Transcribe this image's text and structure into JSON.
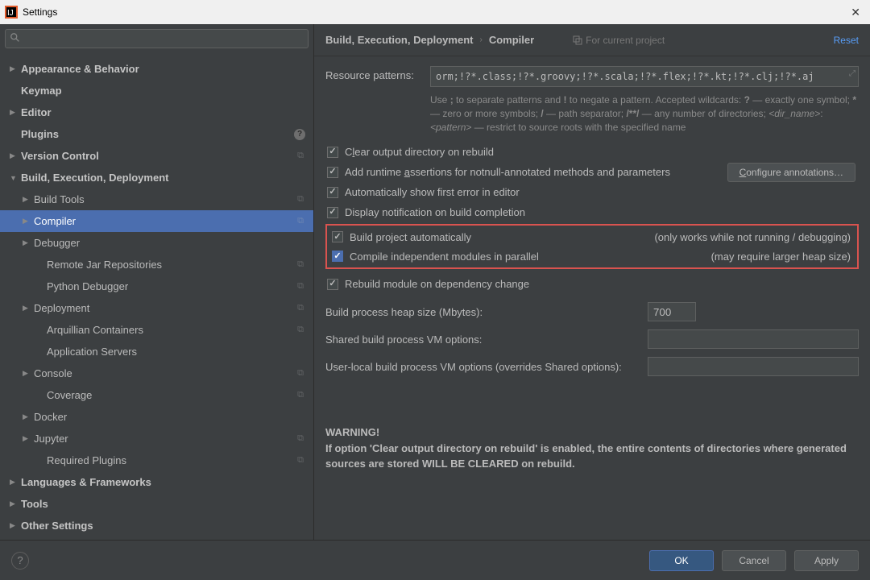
{
  "titlebar": {
    "title": "Settings"
  },
  "search": {
    "placeholder": ""
  },
  "sidebar": {
    "items": [
      {
        "label": "Appearance & Behavior",
        "arrow": "right",
        "lvl": 0,
        "bold": true
      },
      {
        "label": "Keymap",
        "arrow": "none",
        "lvl": 0,
        "bold": true
      },
      {
        "label": "Editor",
        "arrow": "right",
        "lvl": 0,
        "bold": true
      },
      {
        "label": "Plugins",
        "arrow": "none",
        "lvl": 0,
        "bold": true,
        "badge": "?"
      },
      {
        "label": "Version Control",
        "arrow": "right",
        "lvl": 0,
        "bold": true,
        "copy": true
      },
      {
        "label": "Build, Execution, Deployment",
        "arrow": "down",
        "lvl": 0,
        "bold": true
      },
      {
        "label": "Build Tools",
        "arrow": "right",
        "lvl": 1,
        "copy": true
      },
      {
        "label": "Compiler",
        "arrow": "right",
        "lvl": 1,
        "copy": true,
        "selected": true
      },
      {
        "label": "Debugger",
        "arrow": "right",
        "lvl": 1
      },
      {
        "label": "Remote Jar Repositories",
        "arrow": "none",
        "lvl": 2,
        "copy": true
      },
      {
        "label": "Python Debugger",
        "arrow": "none",
        "lvl": 2,
        "copy": true
      },
      {
        "label": "Deployment",
        "arrow": "right",
        "lvl": 1,
        "copy": true
      },
      {
        "label": "Arquillian Containers",
        "arrow": "none",
        "lvl": 2,
        "copy": true
      },
      {
        "label": "Application Servers",
        "arrow": "none",
        "lvl": 2
      },
      {
        "label": "Console",
        "arrow": "right",
        "lvl": 1,
        "copy": true
      },
      {
        "label": "Coverage",
        "arrow": "none",
        "lvl": 2,
        "copy": true
      },
      {
        "label": "Docker",
        "arrow": "right",
        "lvl": 1
      },
      {
        "label": "Jupyter",
        "arrow": "right",
        "lvl": 1,
        "copy": true
      },
      {
        "label": "Required Plugins",
        "arrow": "none",
        "lvl": 2,
        "copy": true
      },
      {
        "label": "Languages & Frameworks",
        "arrow": "right",
        "lvl": 0,
        "bold": true
      },
      {
        "label": "Tools",
        "arrow": "right",
        "lvl": 0,
        "bold": true
      },
      {
        "label": "Other Settings",
        "arrow": "right",
        "lvl": 0,
        "bold": true
      }
    ]
  },
  "header": {
    "crumb1": "Build, Execution, Deployment",
    "crumb2": "Compiler",
    "for_project": "For current project",
    "reset": "Reset"
  },
  "form": {
    "resource_label": "Resource patterns:",
    "resource_value": "orm;!?*.class;!?*.groovy;!?*.scala;!?*.flex;!?*.kt;!?*.clj;!?*.aj",
    "hint1": "Use ; to separate patterns and ! to negate a pattern. Accepted wildcards: ? — exactly one symbol; * — zero or more symbols; / — path separator; /**/ — any number of directories; <dir_name>:<pattern> — restrict to source roots with the specified name",
    "chk_clear": "Clear output directory on rebuild",
    "chk_assert": "Add runtime assertions for notnull-annotated methods and parameters",
    "btn_configure": "Configure annotations…",
    "chk_firsterr": "Automatically show first error in editor",
    "chk_notify": "Display notification on build completion",
    "chk_auto": "Build project automatically",
    "hint_auto": "(only works while not running / debugging)",
    "chk_parallel": "Compile independent modules in parallel",
    "hint_parallel": "(may require larger heap size)",
    "chk_rebuild": "Rebuild module on dependency change",
    "heap_label": "Build process heap size (Mbytes):",
    "heap_value": "700",
    "shared_label": "Shared build process VM options:",
    "userlocal_label": "User-local build process VM options (overrides Shared options):",
    "warning_title": "WARNING!",
    "warning_text": "If option 'Clear output directory on rebuild' is enabled, the entire contents of directories where generated sources are stored WILL BE CLEARED on rebuild."
  },
  "footer": {
    "ok": "OK",
    "cancel": "Cancel",
    "apply": "Apply"
  }
}
